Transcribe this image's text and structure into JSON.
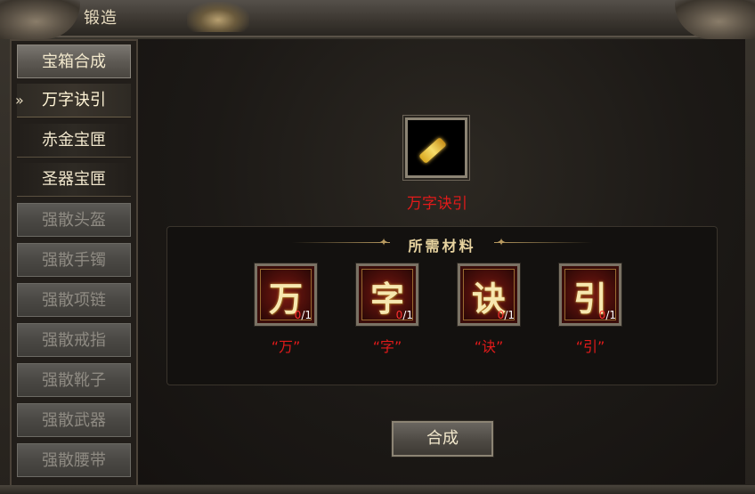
{
  "window": {
    "title": "锻造"
  },
  "sidebar": {
    "items": [
      {
        "label": "宝箱合成",
        "state": "tab"
      },
      {
        "label": "万字诀引",
        "state": "active"
      },
      {
        "label": "赤金宝匣",
        "state": "normal"
      },
      {
        "label": "圣器宝匣",
        "state": "normal"
      },
      {
        "label": "强散头盔",
        "state": "disabled"
      },
      {
        "label": "强散手镯",
        "state": "disabled"
      },
      {
        "label": "强散项链",
        "state": "disabled"
      },
      {
        "label": "强散戒指",
        "state": "disabled"
      },
      {
        "label": "强散靴子",
        "state": "disabled"
      },
      {
        "label": "强散武器",
        "state": "disabled"
      },
      {
        "label": "强散腰带",
        "state": "disabled"
      }
    ],
    "active_marker": "»"
  },
  "preview": {
    "name": "万字诀引",
    "icon": "golden-scroll-icon"
  },
  "materials": {
    "title": "所需材料",
    "items": [
      {
        "glyph": "万",
        "have": "0",
        "need": "/1",
        "label": "“万”"
      },
      {
        "glyph": "字",
        "have": "0",
        "need": "/1",
        "label": "“字”"
      },
      {
        "glyph": "诀",
        "have": "0",
        "need": "/1",
        "label": "“诀”"
      },
      {
        "glyph": "引",
        "have": "0",
        "need": "/1",
        "label": "“引”"
      }
    ]
  },
  "craft_button": {
    "label": "合成"
  },
  "colors": {
    "accent_red": "#e21a1a",
    "gold": "#e8d4a0",
    "text_light": "#f2e8cc",
    "disabled_text": "#8e8a82"
  }
}
